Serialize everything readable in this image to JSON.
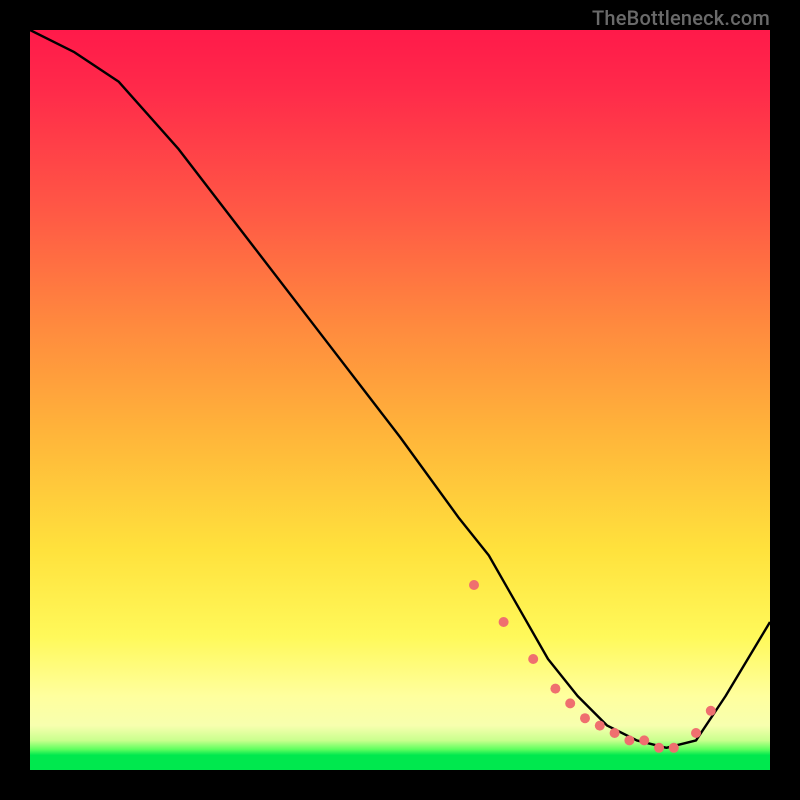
{
  "watermark": "TheBottleneck.com",
  "chart_data": {
    "type": "line",
    "title": "",
    "xlabel": "",
    "ylabel": "",
    "xlim": [
      0,
      100
    ],
    "ylim": [
      0,
      100
    ],
    "series": [
      {
        "name": "curve",
        "x": [
          0,
          6,
          12,
          20,
          30,
          40,
          50,
          58,
          62,
          66,
          70,
          74,
          78,
          82,
          86,
          90,
          94,
          100
        ],
        "y": [
          100,
          97,
          93,
          84,
          71,
          58,
          45,
          34,
          29,
          22,
          15,
          10,
          6,
          4,
          3,
          4,
          10,
          20
        ]
      }
    ],
    "markers": {
      "name": "highlight-points",
      "x": [
        60,
        64,
        68,
        71,
        73,
        75,
        77,
        79,
        81,
        83,
        85,
        87,
        90,
        92
      ],
      "y": [
        25,
        20,
        15,
        11,
        9,
        7,
        6,
        5,
        4,
        4,
        3,
        3,
        5,
        8
      ]
    },
    "gradient_stops": [
      {
        "pos": 0.0,
        "color": "#ff1a4a"
      },
      {
        "pos": 0.25,
        "color": "#ff5a45"
      },
      {
        "pos": 0.55,
        "color": "#ffb63a"
      },
      {
        "pos": 0.82,
        "color": "#fff95a"
      },
      {
        "pos": 0.94,
        "color": "#f7ffae"
      },
      {
        "pos": 0.98,
        "color": "#00e84e"
      }
    ]
  }
}
